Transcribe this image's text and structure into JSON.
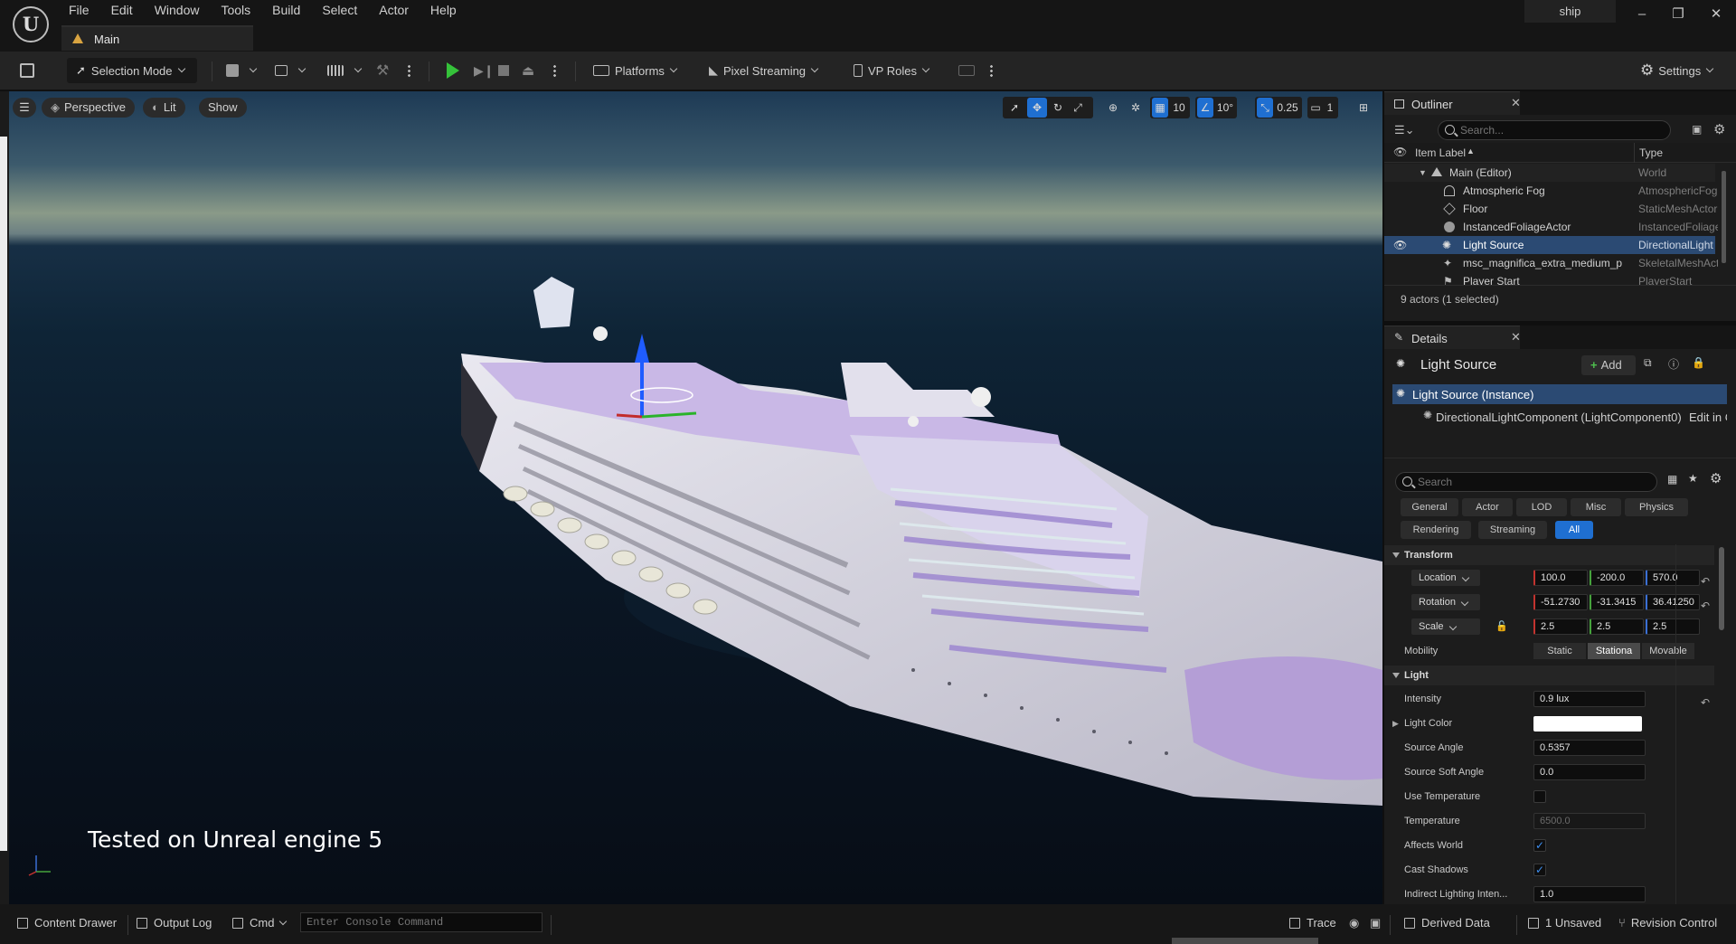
{
  "menu": [
    "File",
    "Edit",
    "Window",
    "Tools",
    "Build",
    "Select",
    "Actor",
    "Help"
  ],
  "level_tab": "Main",
  "project_name": "ship",
  "toolbar": {
    "selection_mode": "Selection Mode",
    "platforms": "Platforms",
    "pixel_streaming": "Pixel Streaming",
    "vp_roles": "VP Roles",
    "settings": "Settings"
  },
  "viewport": {
    "perspective": "Perspective",
    "lit": "Lit",
    "show": "Show",
    "grid_snap": "10",
    "rot_snap": "10°",
    "scale_snap": "0.25",
    "camera_speed": "1",
    "caption": "Tested on Unreal engine 5"
  },
  "outliner": {
    "title": "Outliner",
    "search_placeholder": "Search...",
    "col_label": "Item Label",
    "col_type": "Type",
    "rows": [
      {
        "label": "Main (Editor)",
        "type": "World"
      },
      {
        "label": "Atmospheric Fog",
        "type": "AtmosphericFog"
      },
      {
        "label": "Floor",
        "type": "StaticMeshActor"
      },
      {
        "label": "InstancedFoliageActor",
        "type": "InstancedFoliageActor"
      },
      {
        "label": "Light Source",
        "type": "DirectionalLight"
      },
      {
        "label": "msc_magnifica_extra_medium_p",
        "type": "SkeletalMeshActor"
      },
      {
        "label": "Player Start",
        "type": "PlayerStart"
      }
    ],
    "footer": "9 actors (1 selected)"
  },
  "details": {
    "title": "Details",
    "actor_name": "Light Source",
    "add_label": "Add",
    "instance_label": "Light Source (Instance)",
    "component_label": "DirectionalLightComponent (LightComponent0)",
    "edit_link": "Edit in C++",
    "search_placeholder": "Search",
    "categories": [
      "General",
      "Actor",
      "LOD",
      "Misc",
      "Physics",
      "Rendering",
      "Streaming",
      "All"
    ],
    "transform": {
      "section": "Transform",
      "location_label": "Location",
      "location": [
        "100.0",
        "-200.0",
        "570.0"
      ],
      "rotation_label": "Rotation",
      "rotation": [
        "-51.2730",
        "-31.3415",
        "36.41250"
      ],
      "scale_label": "Scale",
      "scale": [
        "2.5",
        "2.5",
        "2.5"
      ],
      "mobility_label": "Mobility",
      "mobility_options": [
        "Static",
        "Stationa",
        "Movable"
      ]
    },
    "light": {
      "section": "Light",
      "intensity_label": "Intensity",
      "intensity": "0.9 lux",
      "light_color_label": "Light Color",
      "light_color": "#ffffff",
      "source_angle_label": "Source Angle",
      "source_angle": "0.5357",
      "source_soft_angle_label": "Source Soft Angle",
      "source_soft_angle": "0.0",
      "use_temperature_label": "Use Temperature",
      "use_temperature": false,
      "temperature_label": "Temperature",
      "temperature": "6500.0",
      "affects_world_label": "Affects World",
      "affects_world": true,
      "cast_shadows_label": "Cast Shadows",
      "cast_shadows": true,
      "indirect_label": "Indirect Lighting Inten...",
      "indirect": "1.0"
    }
  },
  "statusbar": {
    "content_drawer": "Content Drawer",
    "output_log": "Output Log",
    "cmd": "Cmd",
    "console_placeholder": "Enter Console Command",
    "trace": "Trace",
    "derived_data": "Derived Data",
    "unsaved": "1 Unsaved",
    "revision_control": "Revision Control"
  },
  "colors": {
    "accent_blue": "#1f6fd1",
    "selection_row": "#2b4a73",
    "play_green": "#35c23a"
  }
}
